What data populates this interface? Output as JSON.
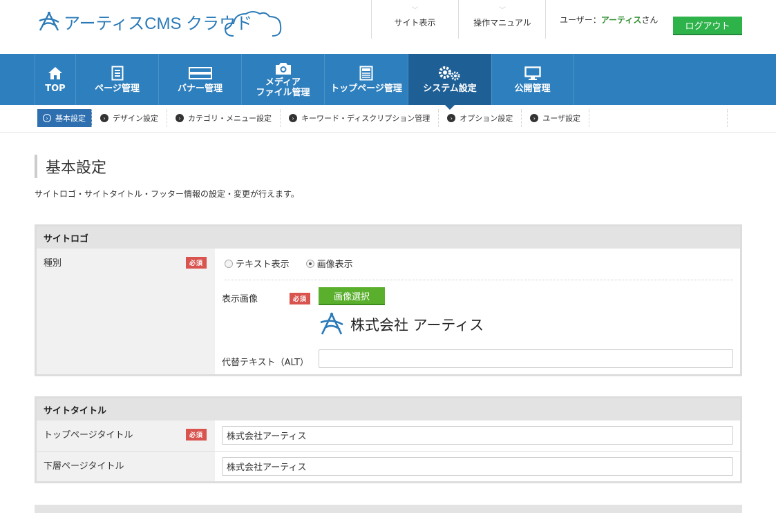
{
  "header": {
    "logo_text": "アーティスCMS クラウド",
    "site_view": "サイト表示",
    "manual": "操作マニュアル",
    "user_prefix": "ユーザー：",
    "user_name": "アーティス",
    "user_suffix": "さん",
    "logout": "ログアウト"
  },
  "nav": [
    {
      "label": "TOP",
      "icon": "home-icon"
    },
    {
      "label": "ページ管理",
      "icon": "document-icon"
    },
    {
      "label": "バナー管理",
      "icon": "banner-icon"
    },
    {
      "label": "メディア",
      "label2": "ファイル管理",
      "icon": "camera-icon"
    },
    {
      "label": "トップページ管理",
      "icon": "layout-icon"
    },
    {
      "label": "システム設定",
      "icon": "gears-icon"
    },
    {
      "label": "公開管理",
      "icon": "monitor-icon"
    }
  ],
  "subnav": [
    "基本設定",
    "デザイン設定",
    "カテゴリ・メニュー設定",
    "キーワード・ディスクリプション管理",
    "オプション設定",
    "ユーザ設定"
  ],
  "page": {
    "title": "基本設定",
    "description": "サイトロゴ・サイトタイトル・フッター情報の設定・変更が行えます。"
  },
  "site_logo": {
    "heading": "サイトロゴ",
    "type_label": "種別",
    "required": "必須",
    "radio_text": "テキスト表示",
    "radio_image": "画像表示",
    "image_label": "表示画像",
    "select_image": "画像選択",
    "preview_text": "株式会社 アーティス",
    "alt_label": "代替テキスト（ALT）",
    "alt_value": ""
  },
  "site_title": {
    "heading": "サイトタイトル",
    "top_label": "トップページタイトル",
    "top_value": "株式会社アーティス",
    "lower_label": "下層ページタイトル",
    "lower_value": "株式会社アーティス",
    "required": "必須"
  },
  "colors": {
    "nav": "#2e7fbe",
    "nav_active": "#1e5f96",
    "logout": "#2eb24a",
    "required": "#d9534f"
  }
}
